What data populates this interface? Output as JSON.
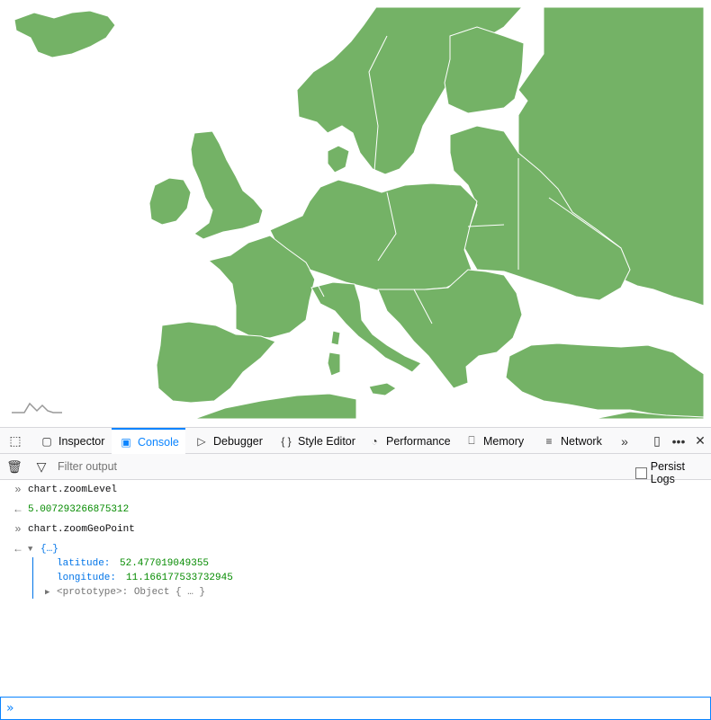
{
  "colors": {
    "land": "#74b266",
    "accent": "#0a84ff",
    "number": "#058b00",
    "object": "#0074e8"
  },
  "map": {
    "logo_icon": "amcharts-logo-icon"
  },
  "devtools": {
    "tabs": [
      {
        "label": "Inspector",
        "icon": "inspector-icon"
      },
      {
        "label": "Console",
        "icon": "console-icon",
        "active": true
      },
      {
        "label": "Debugger",
        "icon": "debugger-icon"
      },
      {
        "label": "Style Editor",
        "icon": "style-editor-icon"
      },
      {
        "label": "Performance",
        "icon": "performance-icon"
      },
      {
        "label": "Memory",
        "icon": "memory-icon"
      },
      {
        "label": "Network",
        "icon": "network-icon"
      }
    ],
    "filter": {
      "placeholder": "Filter output",
      "value": ""
    },
    "persist_logs_label": "Persist Logs",
    "persist_logs_checked": false
  },
  "console": {
    "lines": [
      {
        "kind": "input",
        "text": "chart.zoomLevel"
      },
      {
        "kind": "result",
        "text": "5.007293266875312"
      },
      {
        "kind": "input",
        "text": "chart.zoomGeoPoint"
      },
      {
        "kind": "object",
        "text": "{…}"
      }
    ],
    "object_props": [
      {
        "key": "latitude:",
        "value": "52.477019049355"
      },
      {
        "key": "longitude:",
        "value": "11.166177533732945"
      }
    ],
    "prototype": "<prototype>: Object { … }",
    "input_value": ""
  }
}
